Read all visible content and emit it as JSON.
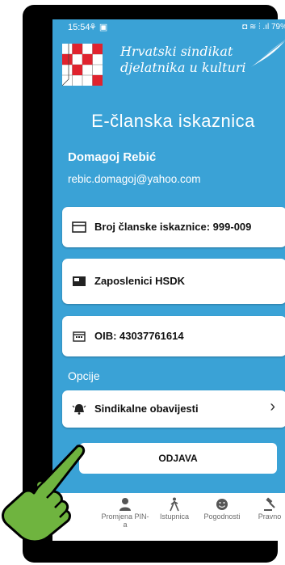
{
  "statusbar": {
    "time": "15:54",
    "left_icons": "⚘ ▣",
    "right_icons": "◘ ≋ ⫶ .ıl 79%"
  },
  "brand": {
    "line1": "Hrvatski sindikat",
    "line2": "djelatnika u kulturi"
  },
  "page": {
    "title": "E-članska iskaznica"
  },
  "user": {
    "name": "Domagoj Rebić",
    "email": "rebic.domagoj@yahoo.com"
  },
  "cards": [
    {
      "icon": "card-icon",
      "label": "Broj članske iskaznice: 999-009"
    },
    {
      "icon": "folder-icon",
      "label": "Zaposlenici HSDK"
    },
    {
      "icon": "calendar-icon",
      "label": "OIB: 43037761614"
    }
  ],
  "options": {
    "header": "Opcije",
    "item_label": "Sindikalne obavijesti",
    "item_chevron": "›"
  },
  "logout_label": "ODJAVA",
  "bottom_nav": [
    {
      "icon": "home-icon",
      "glyph": "⌂",
      "label": "a"
    },
    {
      "icon": "person-icon",
      "glyph": "👤",
      "label": "Promjena PIN-a"
    },
    {
      "icon": "walking-icon",
      "glyph": "🚶",
      "label": "Istupnica"
    },
    {
      "icon": "smile-icon",
      "glyph": "☻",
      "label": "Pogodnosti"
    },
    {
      "icon": "gavel-icon",
      "glyph": "⚖",
      "label": "Pravno"
    }
  ],
  "system_nav": {
    "recent": "|||",
    "home": "◯",
    "back": "‹"
  },
  "colors": {
    "background": "#3aa2d6",
    "card": "#ffffff",
    "hand": "#6fb43f"
  }
}
